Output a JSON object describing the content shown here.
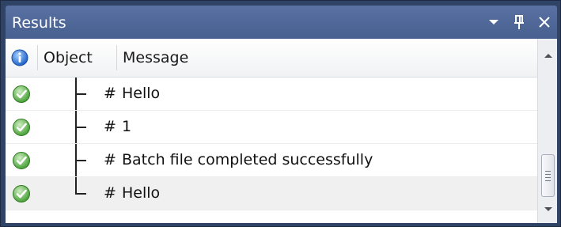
{
  "window": {
    "title": "Results",
    "controls": [
      {
        "name": "dropdown-arrow-icon"
      },
      {
        "name": "pin-icon"
      },
      {
        "name": "close-icon"
      }
    ]
  },
  "grid": {
    "columns": {
      "status_icon": "info-icon",
      "object": "Object",
      "message": "Message"
    },
    "rows": [
      {
        "status": "success-check-icon",
        "tree": "branch",
        "object": "#",
        "message": "Hello"
      },
      {
        "status": "success-check-icon",
        "tree": "branch",
        "object": "#",
        "message": "1"
      },
      {
        "status": "success-check-icon",
        "tree": "branch",
        "object": "#",
        "message": "Batch file completed successfully"
      },
      {
        "status": "success-check-icon",
        "tree": "last-branch",
        "object": "#",
        "message": "Hello"
      }
    ]
  },
  "scrollbar": {
    "up": "up-arrow-icon",
    "down": "down-arrow-icon",
    "thumb": "scroll-thumb"
  },
  "colors": {
    "titlebar": "#4f689a",
    "frame": "#2e4366",
    "alt_row": "#f0f0f0",
    "success": "#3c9a2a",
    "info": "#2a6fd6"
  }
}
